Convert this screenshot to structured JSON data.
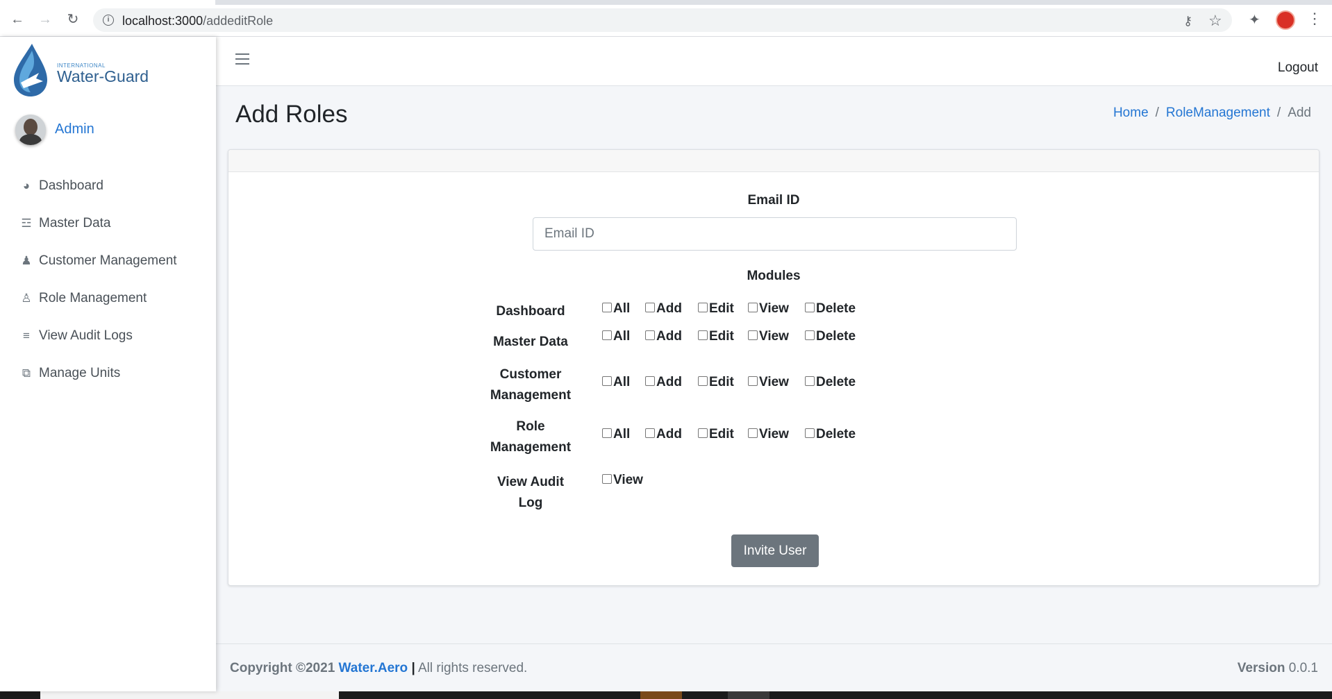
{
  "browser": {
    "url_host": "localhost:3000",
    "url_path": "/addeditRole"
  },
  "brand": {
    "small": "INTERNATIONAL",
    "name": "Water-Guard"
  },
  "user": {
    "name": "Admin"
  },
  "sidebar": {
    "items": [
      {
        "label": "Dashboard",
        "icon": "tachometer-icon"
      },
      {
        "label": "Master Data",
        "icon": "database-icon"
      },
      {
        "label": "Customer Management",
        "icon": "users-icon"
      },
      {
        "label": "Role Management",
        "icon": "user-tie-icon"
      },
      {
        "label": "View Audit Logs",
        "icon": "list-icon"
      },
      {
        "label": "Manage Units",
        "icon": "clone-icon"
      }
    ]
  },
  "header": {
    "logout": "Logout"
  },
  "page": {
    "title": "Add Roles",
    "breadcrumb": {
      "home": "Home",
      "section": "RoleManagement",
      "current": "Add",
      "separator": "/"
    }
  },
  "form": {
    "email_label": "Email ID",
    "email_placeholder": "Email ID",
    "email_value": "",
    "modules_label": "Modules",
    "modules": [
      {
        "line1": "Dashboard",
        "line2": "",
        "perms": [
          "All",
          "Add",
          "Edit",
          "View",
          "Delete"
        ]
      },
      {
        "line1": "Master Data",
        "line2": "",
        "perms": [
          "All",
          "Add",
          "Edit",
          "View",
          "Delete"
        ]
      },
      {
        "line1": "Customer",
        "line2": "Management",
        "perms": [
          "All",
          "Add",
          "Edit",
          "View",
          "Delete"
        ]
      },
      {
        "line1": "Role",
        "line2": "Management",
        "perms": [
          "All",
          "Add",
          "Edit",
          "View",
          "Delete"
        ]
      },
      {
        "line1": "View Audit",
        "line2": "Log",
        "perms": [
          "View"
        ]
      }
    ],
    "submit_label": "Invite User"
  },
  "footer": {
    "copyright": "Copyright ©2021",
    "company": "Water.Aero",
    "bar": "|",
    "rights": "All rights reserved.",
    "version_label": "Version",
    "version_value": "0.0.1"
  },
  "colors": {
    "link": "#2476d3",
    "button": "#6c757d",
    "background": "#f4f6f9"
  }
}
